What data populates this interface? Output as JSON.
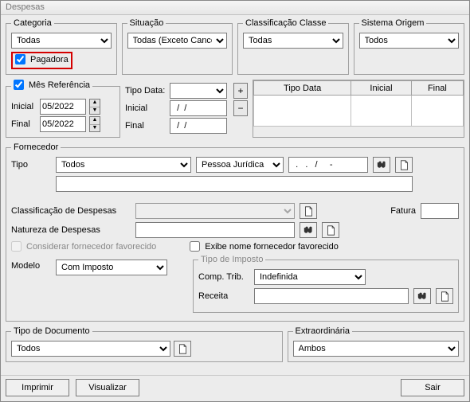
{
  "window": {
    "title": "Despesas"
  },
  "categoria": {
    "legend": "Categoria",
    "value": "Todas",
    "pagadora_checked": true,
    "pagadora_label": "Pagadora"
  },
  "situacao": {
    "legend": "Situação",
    "value": "Todas (Exceto Canceladas)"
  },
  "classe": {
    "legend": "Classificação Classe",
    "value": "Todas"
  },
  "sistema": {
    "legend": "Sistema Origem",
    "value": "Todos"
  },
  "mesref": {
    "checked": true,
    "legend": "Mês Referência",
    "inicial_label": "Inicial",
    "final_label": "Final",
    "inicial": "05/2022",
    "final": "05/2022"
  },
  "tipodata": {
    "label": "Tipo Data:",
    "value": "",
    "inicial_label": "Inicial",
    "final_label": "Final",
    "inicial": "  /  /",
    "final": "  /  /",
    "plus": "+",
    "minus": "−",
    "grid_headers": [
      "Tipo Data",
      "Inicial",
      "Final"
    ]
  },
  "fornecedor": {
    "legend": "Fornecedor",
    "tipo_label": "Tipo",
    "tipo_value": "Todos",
    "pessoa_value": "Pessoa Jurídica",
    "mask_value": "  .   .   /     -",
    "nome_value": "",
    "classif_label": "Classificação de Despesas",
    "classif_value": "",
    "natureza_label": "Natureza de Despesas",
    "natureza_value": "",
    "fatura_label": "Fatura",
    "fatura_value": "",
    "considerar_label": "Considerar fornecedor favorecido",
    "considerar_checked": false,
    "exibe_label": "Exibe nome fornecedor favorecido",
    "exibe_checked": false,
    "modelo_label": "Modelo",
    "modelo_value": "Com Imposto",
    "tipo_imposto_legend": "Tipo de Imposto",
    "comp_trib_label": "Comp. Trib.",
    "comp_trib_value": "Indefinida",
    "receita_label": "Receita",
    "receita_value": ""
  },
  "tipo_doc": {
    "legend": "Tipo de Documento",
    "value": "Todos"
  },
  "extra": {
    "legend": "Extraordinária",
    "value": "Ambos"
  },
  "buttons": {
    "imprimir": "Imprimir",
    "visualizar": "Visualizar",
    "sair": "Sair"
  },
  "spin": {
    "up": "▲",
    "down": "▼"
  }
}
